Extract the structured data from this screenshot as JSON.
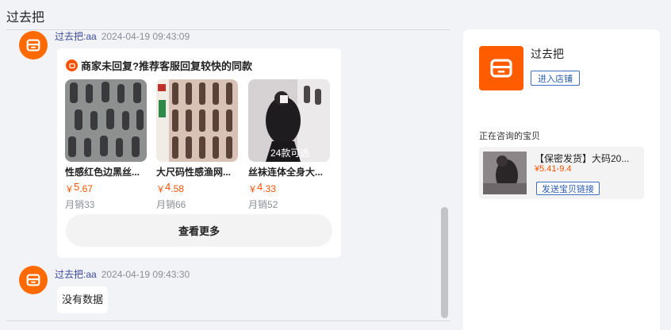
{
  "header": {
    "title": "过去把"
  },
  "messages": [
    {
      "sender": "过去把:aa",
      "time": "2024-04-19 09:43:09"
    },
    {
      "sender": "过去把:aa",
      "time": "2024-04-19 09:43:30",
      "text": "没有数据"
    }
  ],
  "recommend_card": {
    "heading": "商家未回复?推荐客服回复较快的同款",
    "products": [
      {
        "name": "性感红色边黑丝...",
        "currency": "￥",
        "price_int": "5",
        "price_dec": ".67",
        "sales": "月销33"
      },
      {
        "name": "大尺码性感渔网...",
        "currency": "￥",
        "price_int": "4",
        "price_dec": ".58",
        "sales": "月销66"
      },
      {
        "name": "丝袜连体全身大...",
        "currency": "￥",
        "price_int": "4",
        "price_dec": ".33",
        "sales": "月销52",
        "overlay_text": "24款可选"
      }
    ],
    "see_more_label": "查看更多"
  },
  "side_panel": {
    "shop_name": "过去把",
    "enter_shop_label": "进入店铺",
    "consulting_label": "正在咨询的宝贝",
    "consulting_item": {
      "title": "【保密发货】大码20...",
      "price": "¥5.41-9.4",
      "send_link_label": "发送宝贝链接"
    }
  },
  "colors": {
    "accent": "#ff5000",
    "link_blue": "#3d6fc6",
    "sender_blue": "#3b4a9a"
  },
  "icons": {
    "avatar": "store-icon",
    "card_badge": "recommend-icon",
    "shop_logo": "store-icon"
  }
}
